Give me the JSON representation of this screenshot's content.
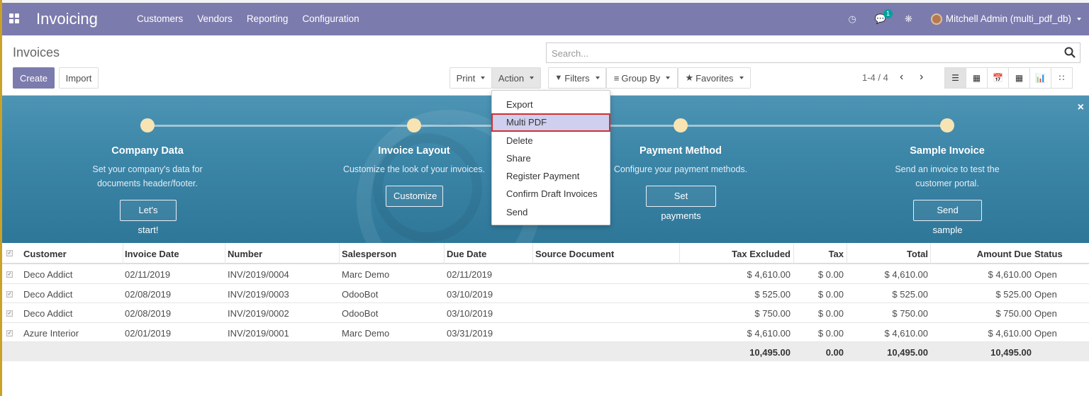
{
  "app": {
    "title": "Invoicing",
    "menu": [
      "Customers",
      "Vendors",
      "Reporting",
      "Configuration"
    ],
    "chat_badge": "1",
    "user": "Mitchell Admin (multi_pdf_db)"
  },
  "control_panel": {
    "breadcrumb": "Invoices",
    "create_label": "Create",
    "import_label": "Import",
    "print_label": "Print",
    "action_label": "Action",
    "search_placeholder": "Search...",
    "filters_label": "Filters",
    "groupby_label": "Group By",
    "favorites_label": "Favorites",
    "pager": "1-4 / 4"
  },
  "action_menu": [
    "Export",
    "Multi PDF",
    "Delete",
    "Share",
    "Register Payment",
    "Confirm Draft Invoices",
    "Send"
  ],
  "onboarding": {
    "steps": [
      {
        "title": "Company Data",
        "desc1": "Set your company's data for",
        "desc2": "documents header/footer.",
        "button": "Let's start!"
      },
      {
        "title": "Invoice Layout",
        "desc1": "Customize the look of your invoices.",
        "desc2": "",
        "button": "Customize"
      },
      {
        "title": "Payment Method",
        "desc1": "Configure your payment methods.",
        "desc2": "",
        "button": "Set payments"
      },
      {
        "title": "Sample Invoice",
        "desc1": "Send an invoice to test the",
        "desc2": "customer portal.",
        "button": "Send sample"
      }
    ]
  },
  "table": {
    "headers": [
      "Customer",
      "Invoice Date",
      "Number",
      "Salesperson",
      "Due Date",
      "Source Document",
      "Tax Excluded",
      "Tax",
      "Total",
      "Amount Due",
      "Status"
    ],
    "rows": [
      [
        "Deco Addict",
        "02/11/2019",
        "INV/2019/0004",
        "Marc Demo",
        "02/11/2019",
        "",
        "$ 4,610.00",
        "$ 0.00",
        "$ 4,610.00",
        "$ 4,610.00",
        "Open"
      ],
      [
        "Deco Addict",
        "02/08/2019",
        "INV/2019/0003",
        "OdooBot",
        "03/10/2019",
        "",
        "$ 525.00",
        "$ 0.00",
        "$ 525.00",
        "$ 525.00",
        "Open"
      ],
      [
        "Deco Addict",
        "02/08/2019",
        "INV/2019/0002",
        "OdooBot",
        "03/10/2019",
        "",
        "$ 750.00",
        "$ 0.00",
        "$ 750.00",
        "$ 750.00",
        "Open"
      ],
      [
        "Azure Interior",
        "02/01/2019",
        "INV/2019/0001",
        "Marc Demo",
        "03/31/2019",
        "",
        "$ 4,610.00",
        "$ 0.00",
        "$ 4,610.00",
        "$ 4,610.00",
        "Open"
      ]
    ],
    "totals": {
      "tax_excluded": "10,495.00",
      "tax": "0.00",
      "total": "10,495.00",
      "amount_due": "10,495.00"
    }
  }
}
